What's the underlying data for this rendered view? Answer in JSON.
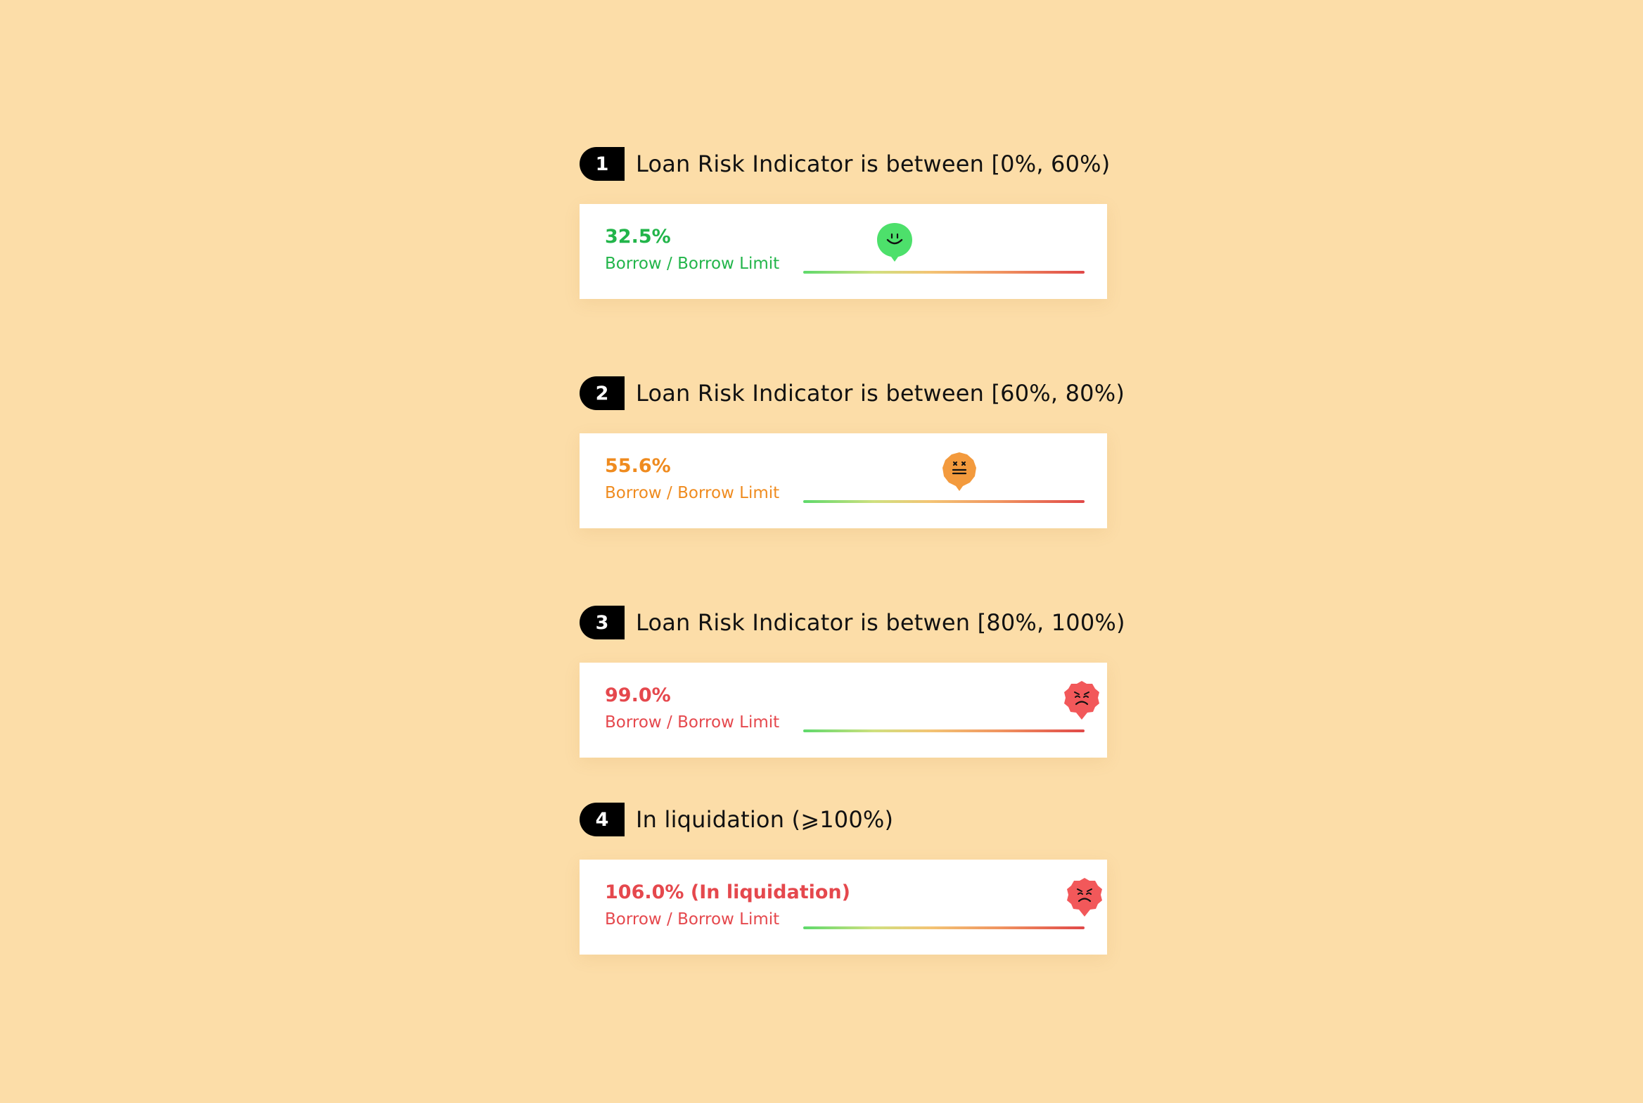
{
  "sections": [
    {
      "number": "1",
      "title": "Loan Risk Indicator is between [0%, 60%)",
      "value": "32.5%",
      "label": "Borrow / Borrow Limit",
      "level_percent": 32.5,
      "status": "healthy",
      "color": "#22B54A",
      "icon": "happy-face-icon"
    },
    {
      "number": "2",
      "title": "Loan Risk Indicator is between [60%, 80%)",
      "value": "55.6%",
      "label": "Borrow / Borrow Limit",
      "level_percent": 55.6,
      "status": "warning",
      "color": "#EF8B1F",
      "icon": "neutral-face-icon"
    },
    {
      "number": "3",
      "title": "Loan Risk Indicator is betwen [80%, 100%)",
      "value": "99.0%",
      "label": "Borrow / Borrow Limit",
      "level_percent": 99.0,
      "status": "danger",
      "color": "#E5484D",
      "icon": "sad-face-icon"
    },
    {
      "number": "4",
      "title": "In liquidation (⩾100%)",
      "value": "106.0% (In liquidation)",
      "label": "Borrow / Borrow Limit",
      "level_percent": 106.0,
      "status": "liquidation",
      "color": "#E5484D",
      "icon": "sad-face-icon"
    }
  ]
}
